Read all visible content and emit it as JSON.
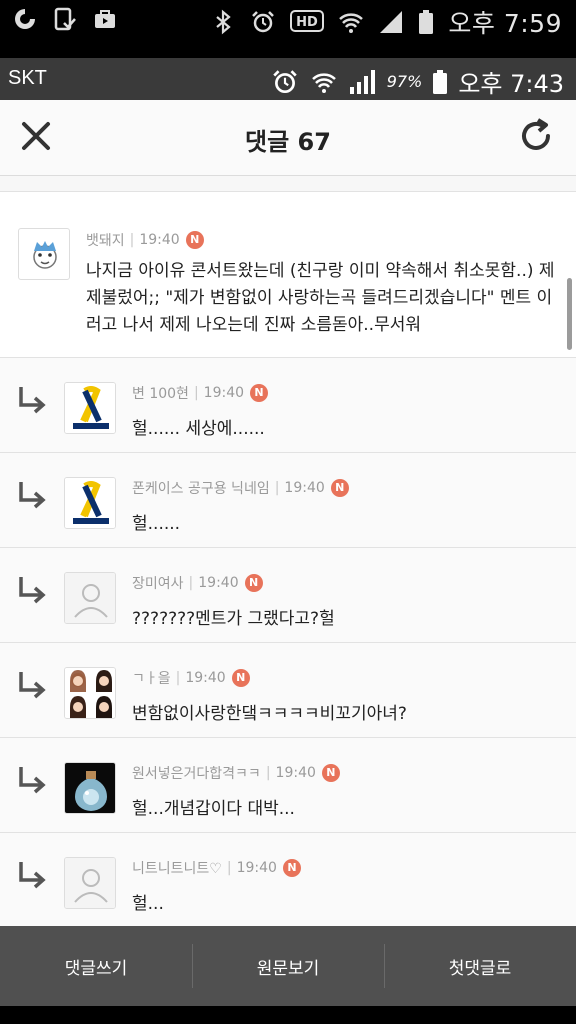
{
  "system_bar": {
    "time": "오후 7:59",
    "icons": [
      "o-app-icon",
      "phone-check-icon",
      "bag-icon",
      "bluetooth-icon",
      "alarm-icon",
      "hd-voice-icon",
      "wifi-icon",
      "signal-icon",
      "battery-icon"
    ]
  },
  "inner_bar": {
    "carrier": "SKT",
    "battery_pct": "97%",
    "time": "오후 7:43"
  },
  "header": {
    "title": "댓글 67"
  },
  "comments": [
    {
      "author": "뱃돼지",
      "time": "19:40",
      "badge": "N",
      "text": "나지금 아이유 콘서트왔는데 (친구랑 이미 약속해서 취소못함..) 제제불렀어;; \"제가 변함없이 사랑하는곡 들려드리겠습니다\" 멘트 이러고 나서 제제 나오는데 진짜 소름돋아..무서워"
    },
    {
      "author": "변 100현",
      "time": "19:40",
      "badge": "N",
      "text": "헐...... 세상에......"
    },
    {
      "author": "폰케이스 공구용 닉네임",
      "time": "19:40",
      "badge": "N",
      "text": "헐......"
    },
    {
      "author": "장미여사",
      "time": "19:40",
      "badge": "N",
      "text": "???????멘트가 그랬다고?헐"
    },
    {
      "author": "ㄱㅏ을",
      "time": "19:40",
      "badge": "N",
      "text": "변함없이사랑한댘ㅋㅋㅋㅋ비꼬기아녀?"
    },
    {
      "author": "원서넣은거다합격ㅋㅋ",
      "time": "19:40",
      "badge": "N",
      "text": "헐...개념갑이다 대박..."
    },
    {
      "author": "니트니트니트♡",
      "time": "19:40",
      "badge": "N",
      "text": "헐..."
    }
  ],
  "bottom_bar": {
    "write": "댓글쓰기",
    "original": "원문보기",
    "first": "첫댓글로"
  }
}
